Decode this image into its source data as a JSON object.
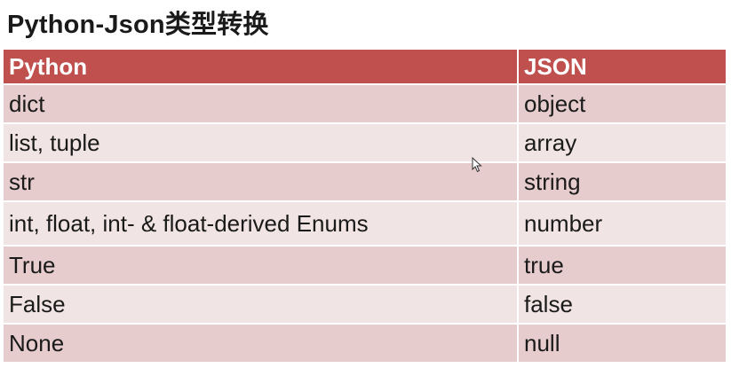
{
  "title": "Python-Json类型转换",
  "table": {
    "headers": [
      "Python",
      "JSON"
    ],
    "rows": [
      [
        "dict",
        "object"
      ],
      [
        "list, tuple",
        "array"
      ],
      [
        "str",
        "string"
      ],
      [
        "int, float, int- & float-derived Enums",
        "number"
      ],
      [
        "True",
        "true"
      ],
      [
        "False",
        "false"
      ],
      [
        "None",
        "null"
      ]
    ]
  },
  "colors": {
    "header_bg": "#c0504d",
    "row_odd_bg": "#e6cccc",
    "row_even_bg": "#f1e4e4"
  },
  "icons": {
    "cursor": "mouse-pointer-icon"
  }
}
